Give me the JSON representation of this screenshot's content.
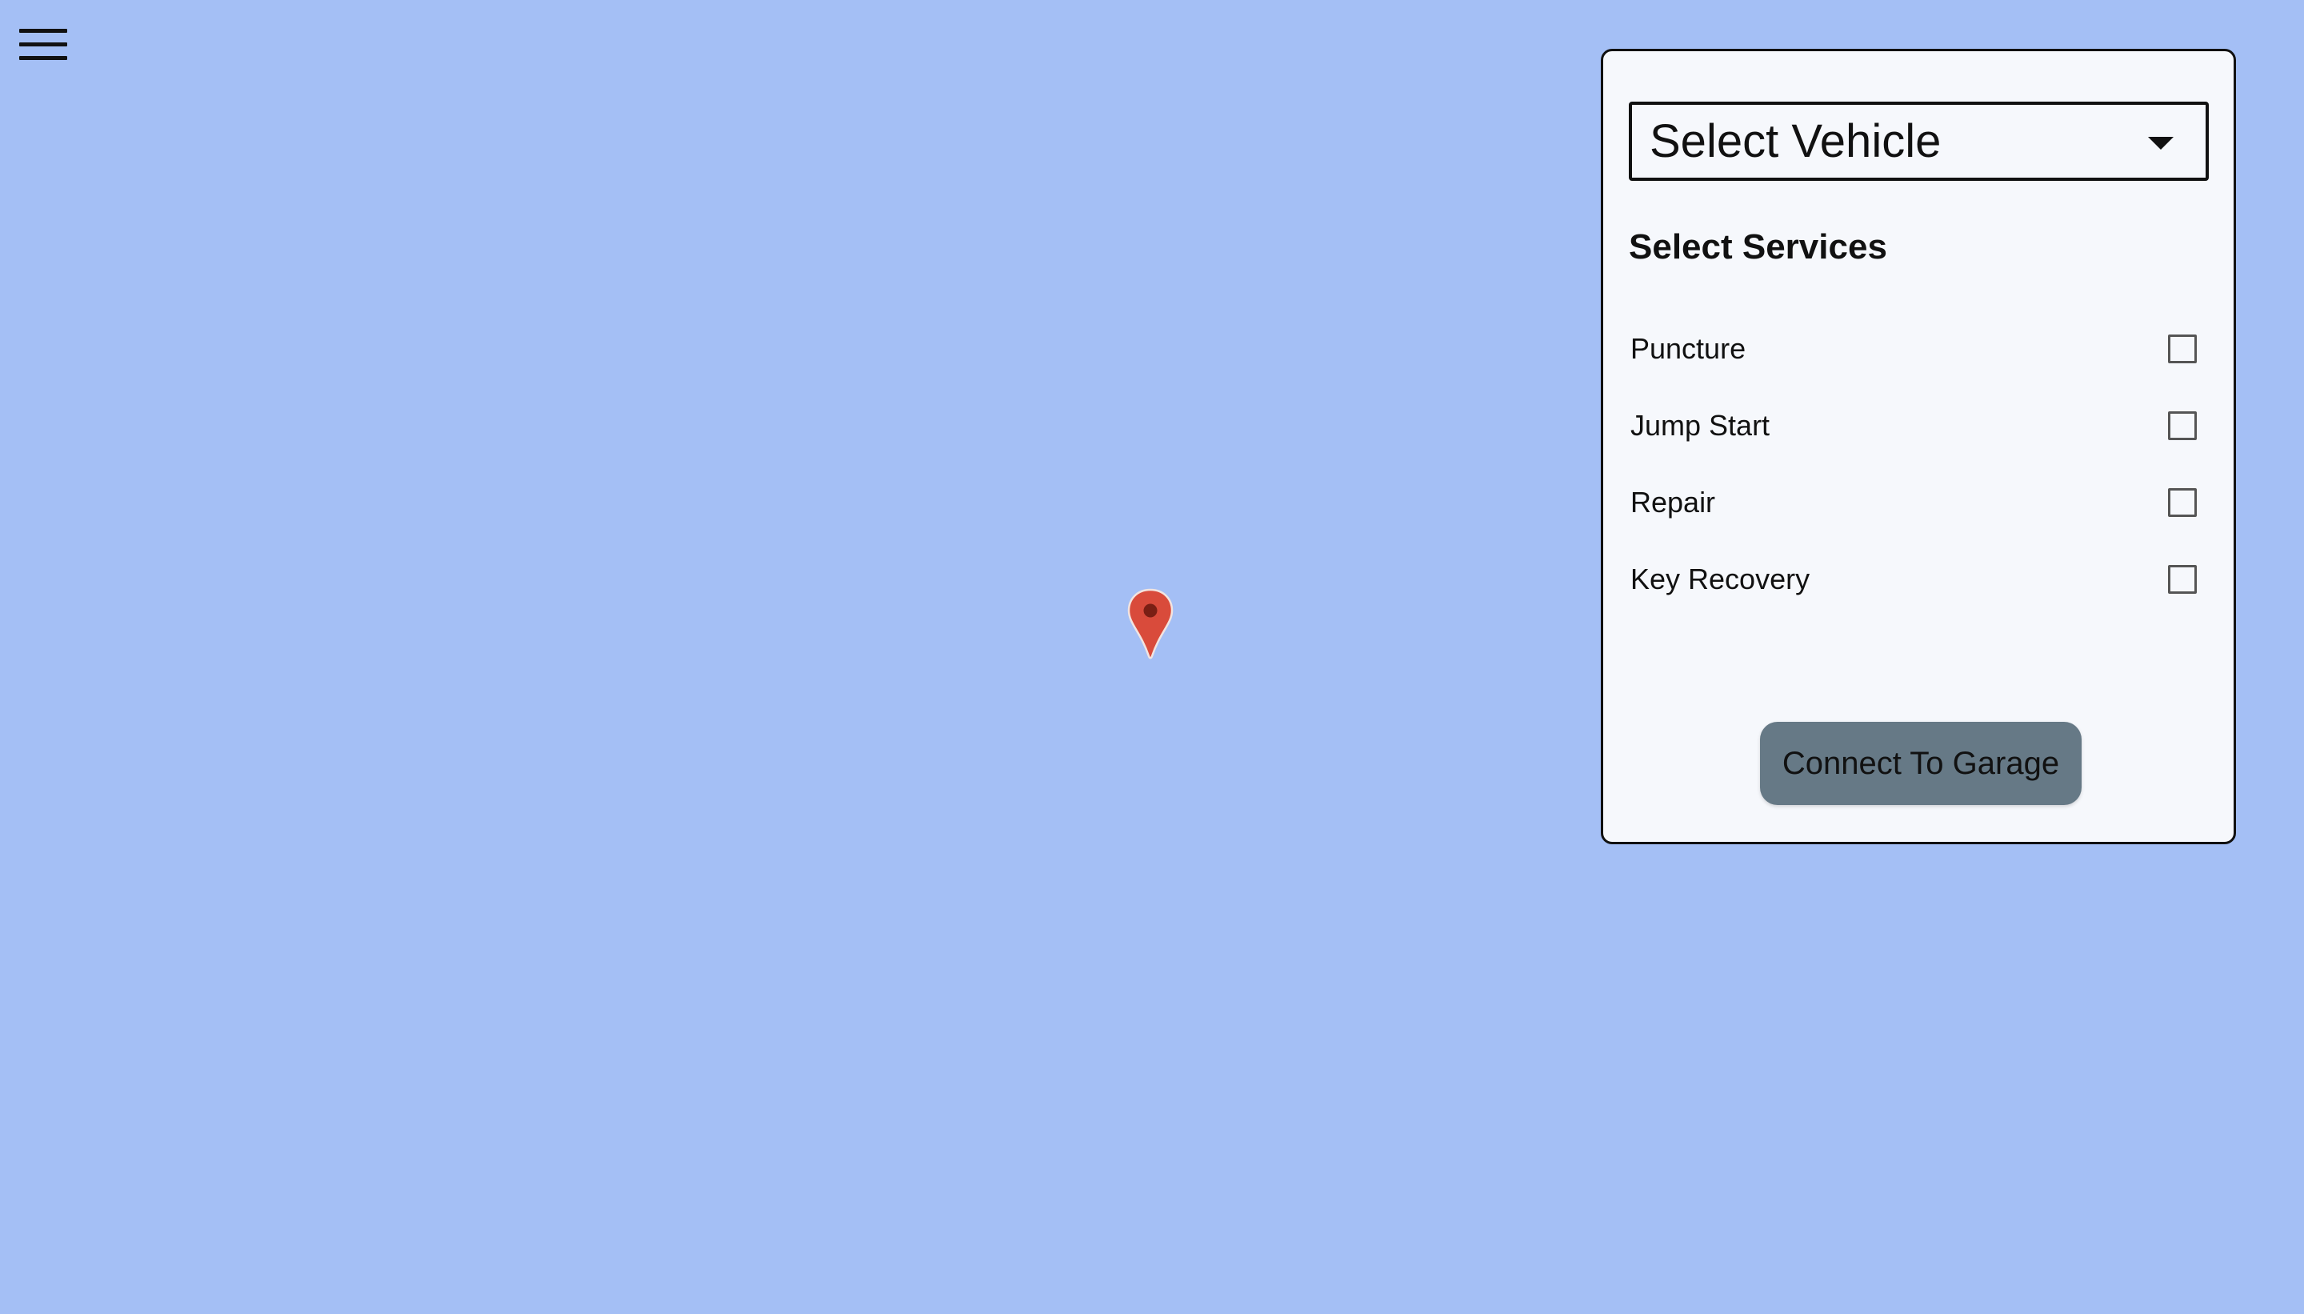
{
  "map": {
    "background_color": "#a4bff5",
    "marker_color": "#d94b3b"
  },
  "menu": {
    "icon": "hamburger-menu-icon"
  },
  "panel": {
    "vehicle_select": {
      "selected_value": "Select Vehicle",
      "icon": "caret-down-icon"
    },
    "services_title": "Select Services",
    "services": [
      {
        "label": "Puncture",
        "checked": false
      },
      {
        "label": "Jump Start",
        "checked": false
      },
      {
        "label": "Repair",
        "checked": false
      },
      {
        "label": "Key Recovery",
        "checked": false
      }
    ],
    "connect_button_label": "Connect To Garage",
    "connect_button_color": "#667986"
  }
}
